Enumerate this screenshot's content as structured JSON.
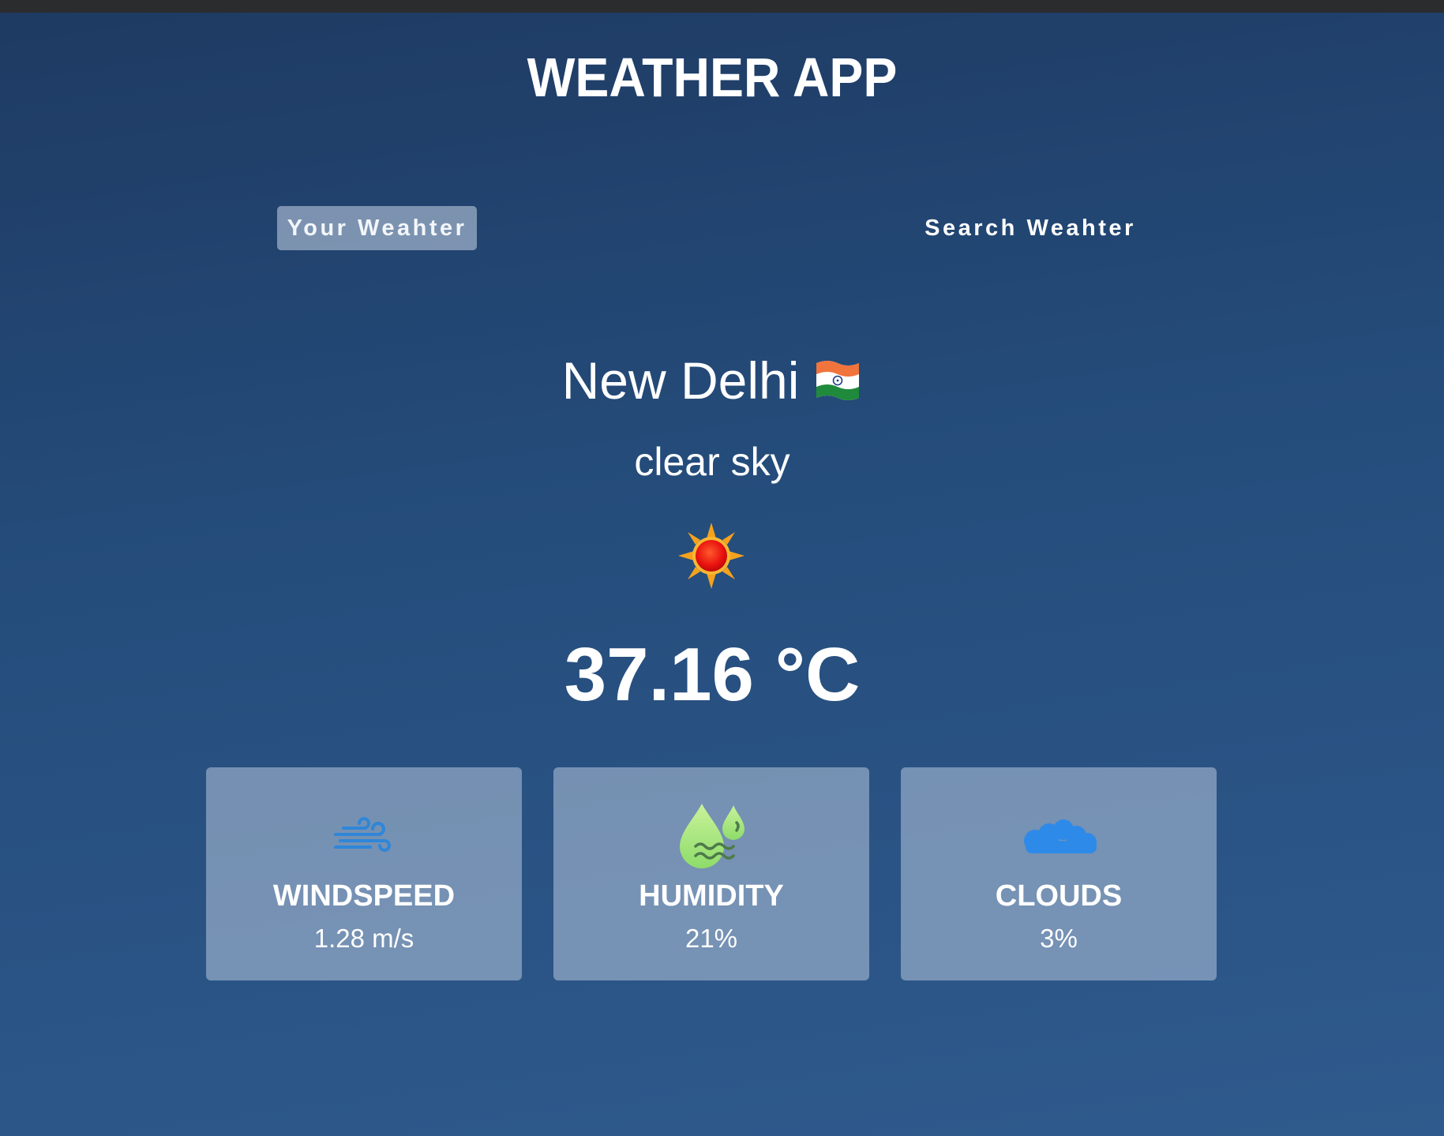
{
  "app": {
    "title": "WEATHER APP"
  },
  "tabs": [
    {
      "label": "Your Weahter",
      "active": true
    },
    {
      "label": "Search Weahter",
      "active": false
    }
  ],
  "location": {
    "city": "New Delhi",
    "flag_icon": "india-flag-icon"
  },
  "weather": {
    "description": "clear sky",
    "condition_icon": "sun-icon",
    "temperature": "37.16 °C"
  },
  "stats": [
    {
      "label": "WINDSPEED",
      "value": "1.28 m/s",
      "icon": "wind-icon"
    },
    {
      "label": "HUMIDITY",
      "value": "21%",
      "icon": "humidity-icon"
    },
    {
      "label": "CLOUDS",
      "value": "3%",
      "icon": "cloud-icon"
    }
  ],
  "colors": {
    "background_top": "#1e3a62",
    "background_bottom": "#2f5a8d",
    "card": "#8299b8",
    "active_tab": "#8aa0bc"
  }
}
